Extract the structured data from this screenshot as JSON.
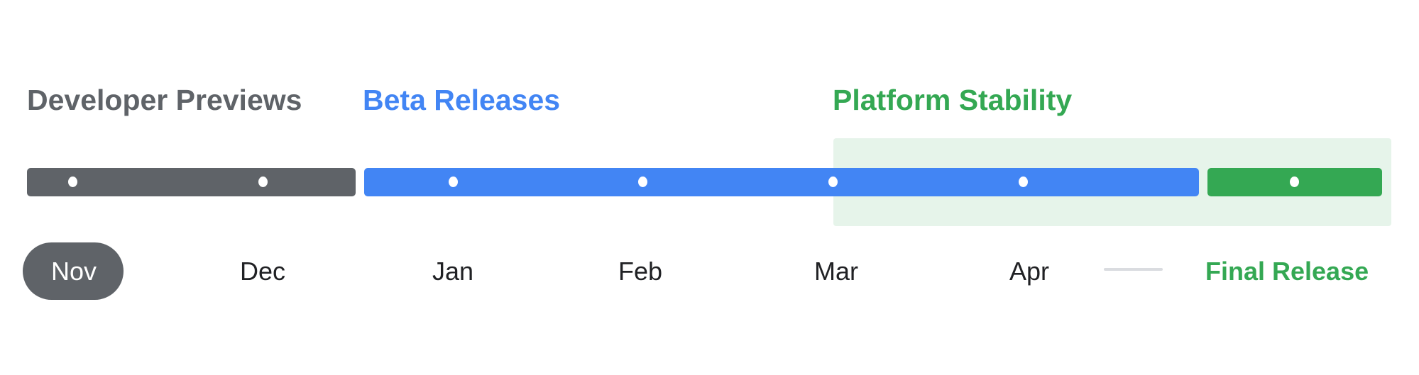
{
  "phases": [
    {
      "label": "Developer Previews",
      "color": "#5f6368"
    },
    {
      "label": "Beta Releases",
      "color": "#4285f4"
    },
    {
      "label": "Platform Stability",
      "color": "#34a853"
    }
  ],
  "months": [
    "Nov",
    "Dec",
    "Jan",
    "Feb",
    "Mar",
    "Apr"
  ],
  "current_month": "Nov",
  "final_release": {
    "label": "Final Release",
    "color": "#34a853"
  },
  "colors": {
    "stability_background": "#e6f4ea",
    "connector": "#dadce0",
    "month_text": "#202124",
    "pill": "#5f6368"
  }
}
